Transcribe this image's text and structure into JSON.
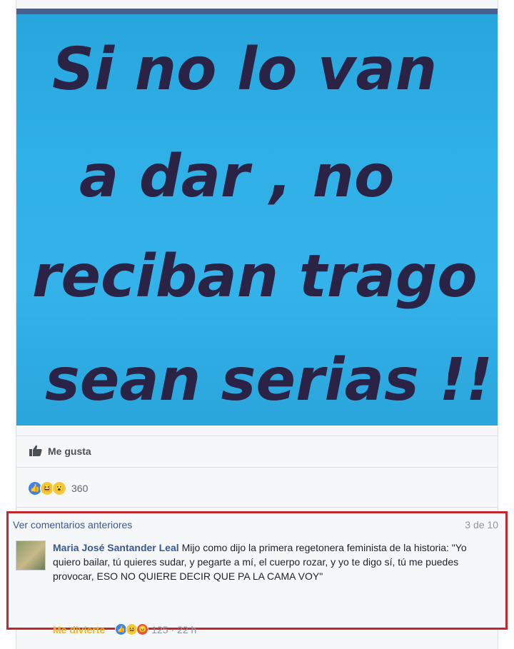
{
  "post": {
    "image_text_lines": [
      "Si no lo van",
      "a dar , no",
      "reciban trago",
      "sean serias !!"
    ]
  },
  "actions": {
    "like_label": "Me gusta"
  },
  "reactions": {
    "icons": [
      "like-icon",
      "haha-icon",
      "wow-icon"
    ],
    "count": "360"
  },
  "comments": {
    "view_previous": "Ver comentarios anteriores",
    "page": "3 de 10",
    "items": [
      {
        "author": "Maria José Santander Leal",
        "text": "Mijo como dijo la primera regetonera feminista de la historia: \"Yo quiero bailar, tú quieres sudar, y pegarte a mí, el cuerpo rozar, y yo te digo sí, tú me puedes provocar, ESO NO QUIERE DECIR QUE PA LA CAMA VOY\"",
        "reaction_label": "Me divierte",
        "reaction_icons": [
          "like-icon",
          "haha-icon",
          "angry-icon"
        ],
        "reaction_count": "125",
        "time": "· 22 h"
      }
    ]
  },
  "colors": {
    "image_bg": "#2fb0e6",
    "handwriting": "#2a2345",
    "link": "#365899",
    "highlight_border": "#c1272d"
  }
}
